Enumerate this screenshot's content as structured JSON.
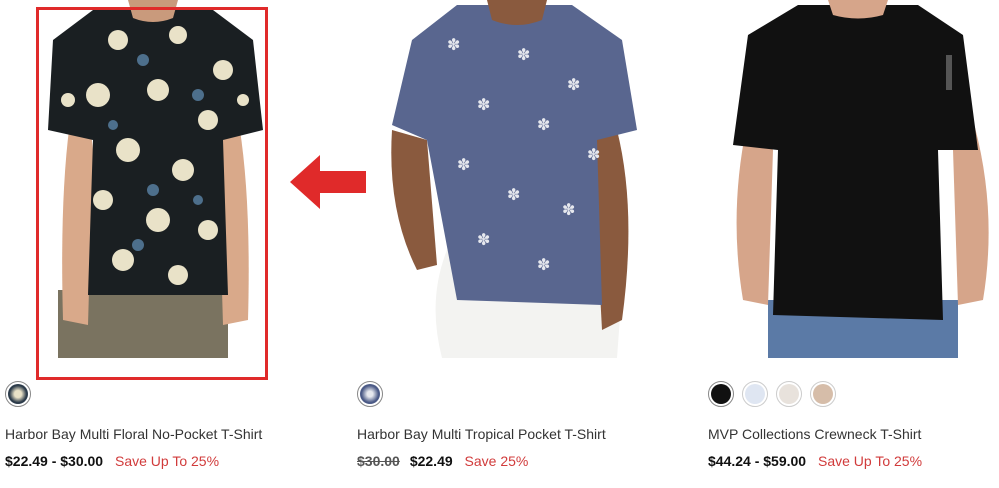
{
  "products": [
    {
      "title": "Harbor Bay Multi Floral No-Pocket T-Shirt",
      "price": "$22.49 - $30.00",
      "original_price": "",
      "save": "Save Up To 25%",
      "swatches": [
        {
          "name": "floral-swatch",
          "color": "#2c3b4a"
        }
      ]
    },
    {
      "title": "Harbor Bay Multi Tropical Pocket T-Shirt",
      "price": "$22.49",
      "original_price": "$30.00",
      "save": "Save 25%",
      "swatches": [
        {
          "name": "tropical-swatch",
          "color": "#4b5a86"
        }
      ]
    },
    {
      "title": "MVP Collections Crewneck T-Shirt",
      "price": "$44.24 - $59.00",
      "original_price": "",
      "save": "Save Up To 25%",
      "swatches": [
        {
          "name": "black-swatch",
          "color": "#111111"
        },
        {
          "name": "light-blue-swatch",
          "color": "#dfe6f2"
        },
        {
          "name": "cream-swatch",
          "color": "#e8e2dc"
        },
        {
          "name": "tan-swatch",
          "color": "#d6bda9"
        }
      ]
    }
  ],
  "colors": {
    "accent": "#e02a2a",
    "save": "#d13b3b"
  },
  "annotation": {
    "arrow_icon": "left-arrow-icon"
  }
}
